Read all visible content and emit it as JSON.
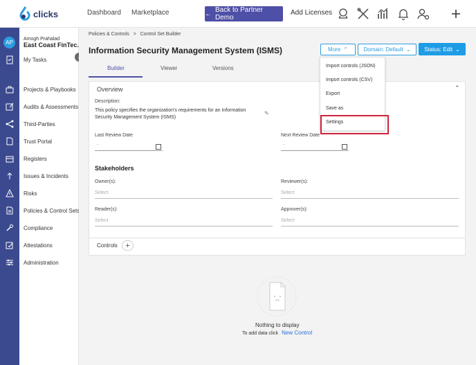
{
  "brand": {
    "name": "clicks",
    "accent": "#4e4fa6",
    "primary": "#1e9ce6"
  },
  "topnav": {
    "links": [
      "Dashboard",
      "Marketplace"
    ],
    "back_button": "Back to Partner Demo",
    "add_licenses": "Add Licenses"
  },
  "user": {
    "initials": "AP",
    "name": "Amogh Prahalad",
    "org": "East Coast FinTec..."
  },
  "sidebar": {
    "items": [
      {
        "label": "My Tasks",
        "icon": "clipboard-icon"
      },
      {
        "label": "Projects & Playbooks",
        "icon": "briefcase-icon"
      },
      {
        "label": "Audits & Assessments",
        "icon": "edit-icon"
      },
      {
        "label": "Third-Parties",
        "icon": "network-icon"
      },
      {
        "label": "Trust Portal",
        "icon": "document-icon"
      },
      {
        "label": "Registers",
        "icon": "folder-icon"
      },
      {
        "label": "Issues & Incidents",
        "icon": "arrow-icon"
      },
      {
        "label": "Risks",
        "icon": "warning-icon"
      },
      {
        "label": "Policies & Control Sets",
        "icon": "policy-icon"
      },
      {
        "label": "Compliance",
        "icon": "wrench-icon"
      },
      {
        "label": "Attestations",
        "icon": "attest-icon"
      },
      {
        "label": "Administration",
        "icon": "sliders-icon"
      }
    ]
  },
  "breadcrumb": {
    "first": "Policies & Controls",
    "separator": ">",
    "second": "Control Set Builder"
  },
  "page": {
    "title": "Information Security Management System (ISMS)"
  },
  "actions": {
    "more": "More",
    "domain": "Domain: Default",
    "status": "Status: Edit"
  },
  "tabs": [
    "Builder",
    "Viewer",
    "Versions"
  ],
  "overview": {
    "header": "Overview",
    "description_label": "Description:",
    "description": "This policy specifies the organization's requirements for an Information Security Management System (ISMS)",
    "last_review_label": "Last Review Date",
    "last_review_value": "-",
    "next_review_label": "Next Review Date",
    "next_review_value": "-"
  },
  "stakeholders": {
    "title": "Stakeholders",
    "owner_label": "Owner(s):",
    "reviewer_label": "Reviewer(s):",
    "reader_label": "Reader(s):",
    "approver_label": "Approver(s):",
    "placeholder": "Select"
  },
  "controls": {
    "label": "Controls",
    "add": "+"
  },
  "empty_state": {
    "title": "Nothing to display",
    "sub": "To add data click",
    "link": "New Control"
  },
  "dropdown": {
    "items": [
      "Import controls (JSON)",
      "Import controls (CSV)",
      "Export",
      "Save as",
      "Settings"
    ]
  }
}
